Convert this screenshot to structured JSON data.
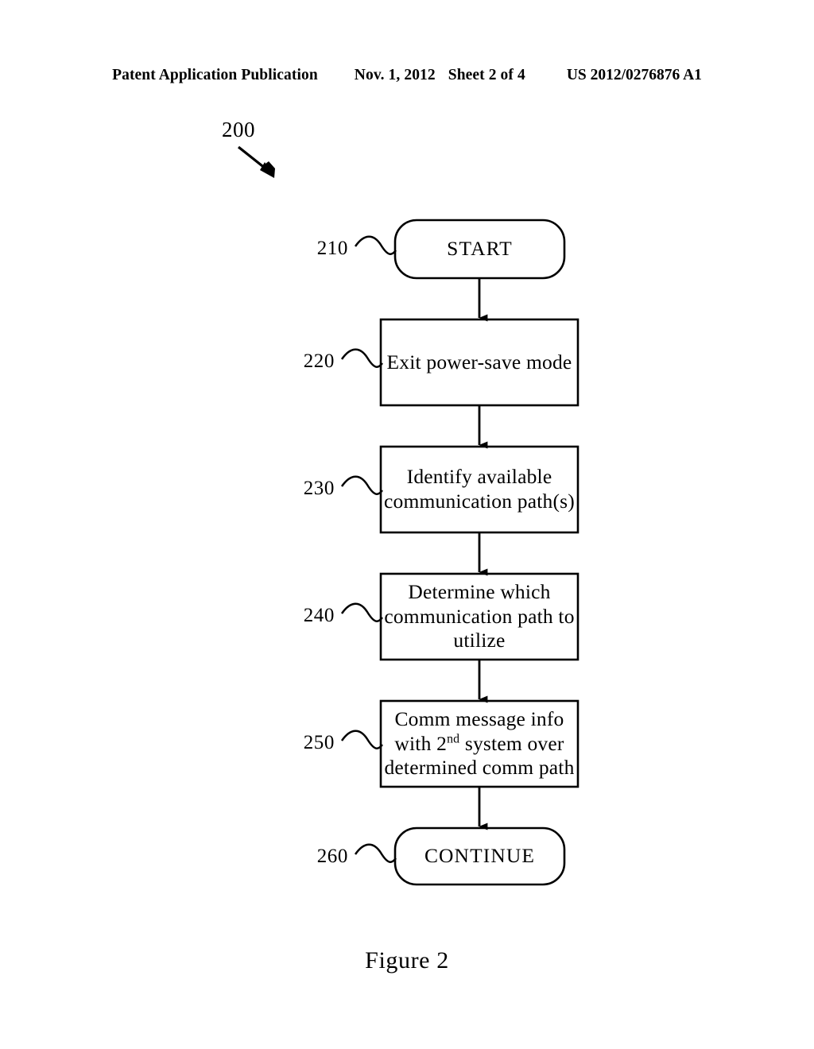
{
  "header": {
    "publication": "Patent Application Publication",
    "date": "Nov. 1, 2012",
    "sheet": "Sheet 2 of 4",
    "patent_number": "US 2012/0276876 A1"
  },
  "figure": {
    "caption": "Figure 2",
    "lead_label": "200",
    "stroke_color": "#000000",
    "fill_color": "#ffffff"
  },
  "flow": {
    "nodes": [
      {
        "ref": "210",
        "shape": "rounded-terminal",
        "line1": "START",
        "line2": "",
        "line3": ""
      },
      {
        "ref": "220",
        "shape": "rectangle",
        "line1": "Exit power-save mode",
        "line2": "",
        "line3": ""
      },
      {
        "ref": "230",
        "shape": "rectangle",
        "line1": "Identify available",
        "line2": "communication path(s)",
        "line3": ""
      },
      {
        "ref": "240",
        "shape": "rectangle",
        "line1": "Determine which",
        "line2": "communication path to",
        "line3": "utilize"
      },
      {
        "ref": "250",
        "shape": "rectangle",
        "line1": "Comm message info",
        "line2_pre": "with 2",
        "line2_sup": "nd",
        "line2_post": " system over",
        "line3": "determined comm path"
      },
      {
        "ref": "260",
        "shape": "rounded-terminal",
        "line1": "CONTINUE",
        "line2": "",
        "line3": ""
      }
    ]
  }
}
